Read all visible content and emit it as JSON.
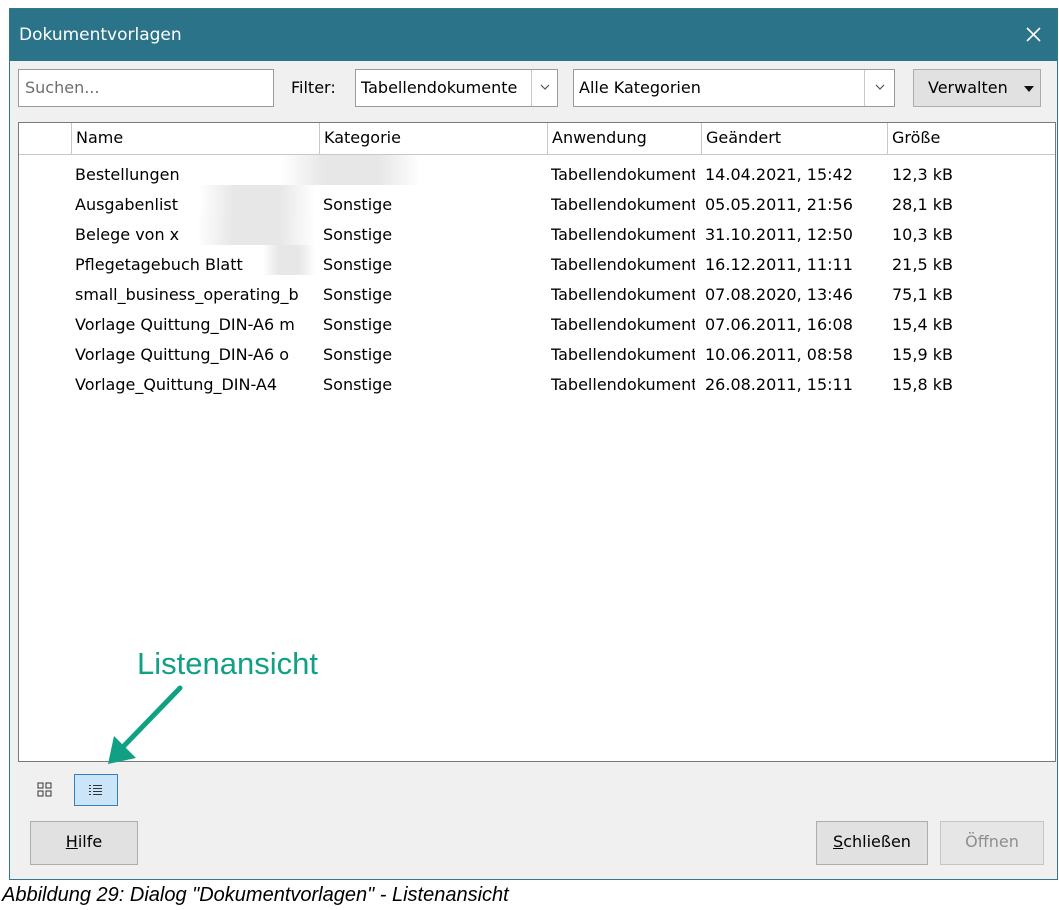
{
  "window": {
    "title": "Dokumentvorlagen",
    "close_icon": "close-icon"
  },
  "toolbar": {
    "search_placeholder": "Suchen...",
    "filter_label": "Filter:",
    "filter_value": "Tabellendokumente",
    "category_value": "Alle Kategorien",
    "manage_label": "Verwalten"
  },
  "table": {
    "columns": [
      "Name",
      "Kategorie",
      "Anwendung",
      "Geändert",
      "Größe"
    ],
    "rows": [
      {
        "name": "Bestellungen",
        "category": "",
        "app": "Tabellendokumente",
        "modified": "14.04.2021, 15:42",
        "size": "12,3 kB"
      },
      {
        "name": "Ausgabenlist",
        "category": "Sonstige",
        "app": "Tabellendokumente",
        "modified": "05.05.2011, 21:56",
        "size": "28,1 kB"
      },
      {
        "name": "Belege von x",
        "category": "Sonstige",
        "app": "Tabellendokumente",
        "modified": "31.10.2011, 12:50",
        "size": "10,3 kB"
      },
      {
        "name": "Pflegetagebuch Blatt",
        "category": "Sonstige",
        "app": "Tabellendokumente",
        "modified": "16.12.2011, 11:11",
        "size": "21,5 kB"
      },
      {
        "name": "small_business_operating_b",
        "category": "Sonstige",
        "app": "Tabellendokumente",
        "modified": "07.08.2020, 13:46",
        "size": "75,1 kB"
      },
      {
        "name": "Vorlage Quittung_DIN-A6 m",
        "category": "Sonstige",
        "app": "Tabellendokumente",
        "modified": "07.06.2011, 16:08",
        "size": "15,4 kB"
      },
      {
        "name": "Vorlage Quittung_DIN-A6 o",
        "category": "Sonstige",
        "app": "Tabellendokumente",
        "modified": "10.06.2011, 08:58",
        "size": "15,9 kB"
      },
      {
        "name": "Vorlage_Quittung_DIN-A4",
        "category": "Sonstige",
        "app": "Tabellendokumente",
        "modified": "26.08.2011, 15:11",
        "size": "15,8 kB"
      }
    ]
  },
  "view": {
    "grid_icon": "grid-view-icon",
    "list_icon": "list-view-icon",
    "active": "list"
  },
  "buttons": {
    "help": "Hilfe",
    "close": "Schließen",
    "open": "Öffnen"
  },
  "annotation": {
    "text": "Listenansicht",
    "color": "#10a185"
  },
  "caption": "Abbildung 29: Dialog \"Dokumentvorlagen\" - Listenansicht",
  "colors": {
    "titlebar": "#2a7388",
    "accent": "#10a185"
  }
}
